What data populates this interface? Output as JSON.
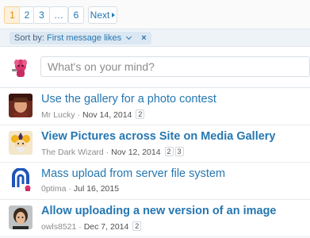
{
  "pagination": {
    "pages": [
      "1",
      "2",
      "3",
      "…",
      "6"
    ],
    "next_label": "Next"
  },
  "filter": {
    "prefix": "Sort by:",
    "value": "First message likes",
    "remove_symbol": "×"
  },
  "composer": {
    "placeholder": "What's on your mind?"
  },
  "threads": [
    {
      "title": "Use the gallery for a photo contest",
      "unread": false,
      "author": "Mr Lucky",
      "date": "Nov 14, 2014",
      "pages": [
        "2"
      ]
    },
    {
      "title": "View Pictures across Site on Media Gallery",
      "unread": true,
      "author": "The Dark Wizard",
      "date": "Nov 12, 2014",
      "pages": [
        "2",
        "3"
      ]
    },
    {
      "title": "Mass upload from server file system",
      "unread": false,
      "author": "0ptima",
      "date": "Jul 16, 2015",
      "pages": []
    },
    {
      "title": "Allow uploading a new version of an image",
      "unread": true,
      "author": "owls8521",
      "date": "Dec 7, 2014",
      "pages": [
        "2"
      ]
    }
  ],
  "colors": {
    "link": "#2577b1",
    "current_page": "#df8a12",
    "filter_bg": "#eef3f8"
  }
}
